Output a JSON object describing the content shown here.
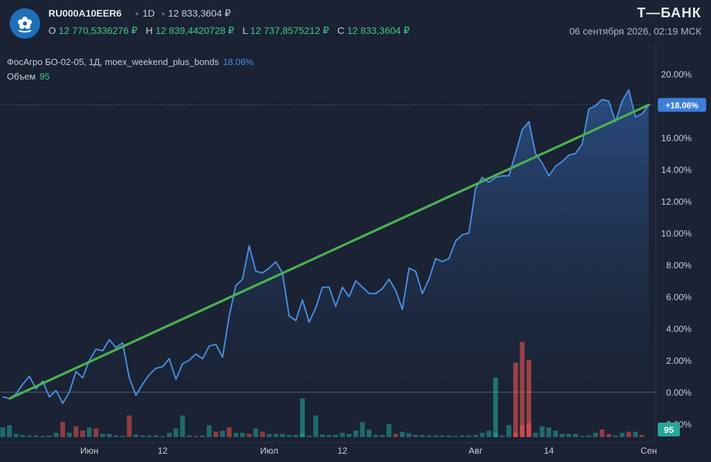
{
  "header": {
    "ticker": "RU000A10EER6",
    "timeframe": "1D",
    "last_price": "12 833,3604 ₽",
    "ohlc": [
      {
        "key": "O",
        "value": "12 770,5336276 ₽"
      },
      {
        "key": "H",
        "value": "12 839,4420728 ₽"
      },
      {
        "key": "L",
        "value": "12 737,8575212 ₽"
      },
      {
        "key": "C",
        "value": "12 833,3604 ₽"
      }
    ],
    "brand": "Т—БАНК",
    "datetime": "06 сентября 2026, 02:19 МСК"
  },
  "legend": {
    "series_label": "ФосАгро БО-02-05, 1Д, moex_weekend_plus_bonds",
    "series_value": "18.06%",
    "volume_label": "Объем",
    "volume_value": "95"
  },
  "colors": {
    "background": "#1a2233",
    "line": "#4a90e2",
    "trend": "#4caf50",
    "volume_up": "#26a69a",
    "volume_down": "#ef5350",
    "accent_green": "#3fc98a"
  },
  "icons": {
    "logo": "flower-logo-icon"
  },
  "chart_data": {
    "type": "line",
    "ylabel": "",
    "xlabel": "",
    "ylim": [
      -2,
      21
    ],
    "y_ticks": [
      "20.00%",
      "18.00%",
      "16.00%",
      "14.00%",
      "12.00%",
      "10.00%",
      "8.00%",
      "6.00%",
      "4.00%",
      "2.00%",
      "0.00%",
      "-2.00%"
    ],
    "x_tick_labels": [
      {
        "label": "Июн",
        "index": 13
      },
      {
        "label": "12",
        "index": 24
      },
      {
        "label": "Июл",
        "index": 40
      },
      {
        "label": "12",
        "index": 51
      },
      {
        "label": "Авг",
        "index": 71
      },
      {
        "label": "14",
        "index": 82
      },
      {
        "label": "Сен",
        "index": 97
      }
    ],
    "last_value_label": "+18.06%",
    "last_value_line": 18.06,
    "series": [
      {
        "values": [
          -0.3,
          -0.4,
          -0.1,
          0.5,
          1.0,
          0.2,
          0.7,
          -0.3,
          0.1,
          -0.7,
          0.0,
          1.3,
          0.9,
          2.0,
          2.7,
          2.6,
          3.3,
          2.8,
          3.1,
          0.9,
          -0.2,
          0.5,
          1.1,
          1.5,
          1.6,
          2.1,
          0.8,
          1.8,
          2.0,
          2.4,
          2.1,
          2.9,
          3.0,
          2.2,
          4.8,
          6.7,
          7.1,
          9.2,
          7.6,
          7.5,
          7.8,
          8.2,
          7.5,
          4.8,
          4.5,
          5.8,
          4.4,
          5.3,
          6.6,
          6.6,
          5.4,
          6.6,
          6.0,
          7.0,
          6.6,
          6.2,
          6.2,
          6.5,
          7.1,
          6.4,
          5.2,
          7.8,
          7.6,
          6.2,
          7.1,
          8.4,
          8.2,
          8.4,
          9.5,
          9.9,
          10.0,
          12.8,
          13.5,
          13.2,
          13.5,
          13.6,
          13.6,
          15.0,
          16.5,
          17.0,
          15.0,
          14.4,
          13.6,
          14.2,
          14.5,
          14.9,
          15.0,
          15.6,
          17.8,
          18.0,
          18.4,
          18.3,
          17.0,
          18.3,
          19.0,
          17.3,
          17.5,
          18.06
        ]
      },
      {
        "name": "",
        "values_start_end": [
          -0.4,
          18.06
        ]
      }
    ],
    "volume": {
      "values": [
        18,
        22,
        6,
        4,
        3,
        3,
        2,
        3,
        8,
        28,
        8,
        20,
        12,
        18,
        16,
        6,
        6,
        3,
        2,
        40,
        5,
        3,
        3,
        3,
        2,
        8,
        16,
        40,
        3,
        2,
        3,
        22,
        10,
        12,
        18,
        8,
        8,
        6,
        16,
        10,
        6,
        6,
        6,
        4,
        4,
        6,
        3,
        40,
        5,
        4,
        4,
        8,
        6,
        12,
        28,
        14,
        4,
        4,
        24,
        6,
        10,
        7,
        4,
        4,
        3,
        3,
        3,
        3,
        2,
        3,
        3,
        4,
        8,
        12,
        8,
        3,
        22,
        8,
        22,
        26,
        8,
        20,
        18,
        12,
        6,
        6,
        6,
        2,
        3,
        8,
        14,
        6,
        3,
        8,
        10,
        10,
        4,
        95
      ],
      "colors": [
        "up",
        "up",
        "up",
        "up",
        "up",
        "up",
        "up",
        "up",
        "up",
        "down",
        "up",
        "down",
        "down",
        "up",
        "down",
        "up",
        "up",
        "up",
        "up",
        "down",
        "up",
        "up",
        "up",
        "up",
        "up",
        "up",
        "up",
        "up",
        "up",
        "down",
        "up",
        "up",
        "down",
        "up",
        "down",
        "up",
        "up",
        "down",
        "up",
        "down",
        "up",
        "up",
        "up",
        "up",
        "up",
        "up",
        "up",
        "up",
        "up",
        "up",
        "up",
        "up",
        "up",
        "up",
        "up",
        "up",
        "up",
        "up",
        "up",
        "down",
        "up",
        "up",
        "up",
        "up",
        "up",
        "up",
        "up",
        "up",
        "up",
        "up",
        "up",
        "up",
        "up",
        "up",
        "up",
        "up",
        "up",
        "down",
        "down",
        "down",
        "up",
        "up",
        "up",
        "up",
        "up",
        "up",
        "up",
        "up",
        "up",
        "up",
        "down",
        "down",
        "up",
        "up",
        "down",
        "up",
        "down",
        "up"
      ],
      "big": [
        {
          "index": 74,
          "value": 20,
          "kind": "up"
        },
        {
          "index": 77,
          "value": 25,
          "kind": "down"
        },
        {
          "index": 78,
          "value": 32,
          "kind": "down"
        },
        {
          "index": 79,
          "value": 26,
          "kind": "down"
        },
        {
          "index": 45,
          "value": 13,
          "kind": "up"
        }
      ]
    }
  }
}
